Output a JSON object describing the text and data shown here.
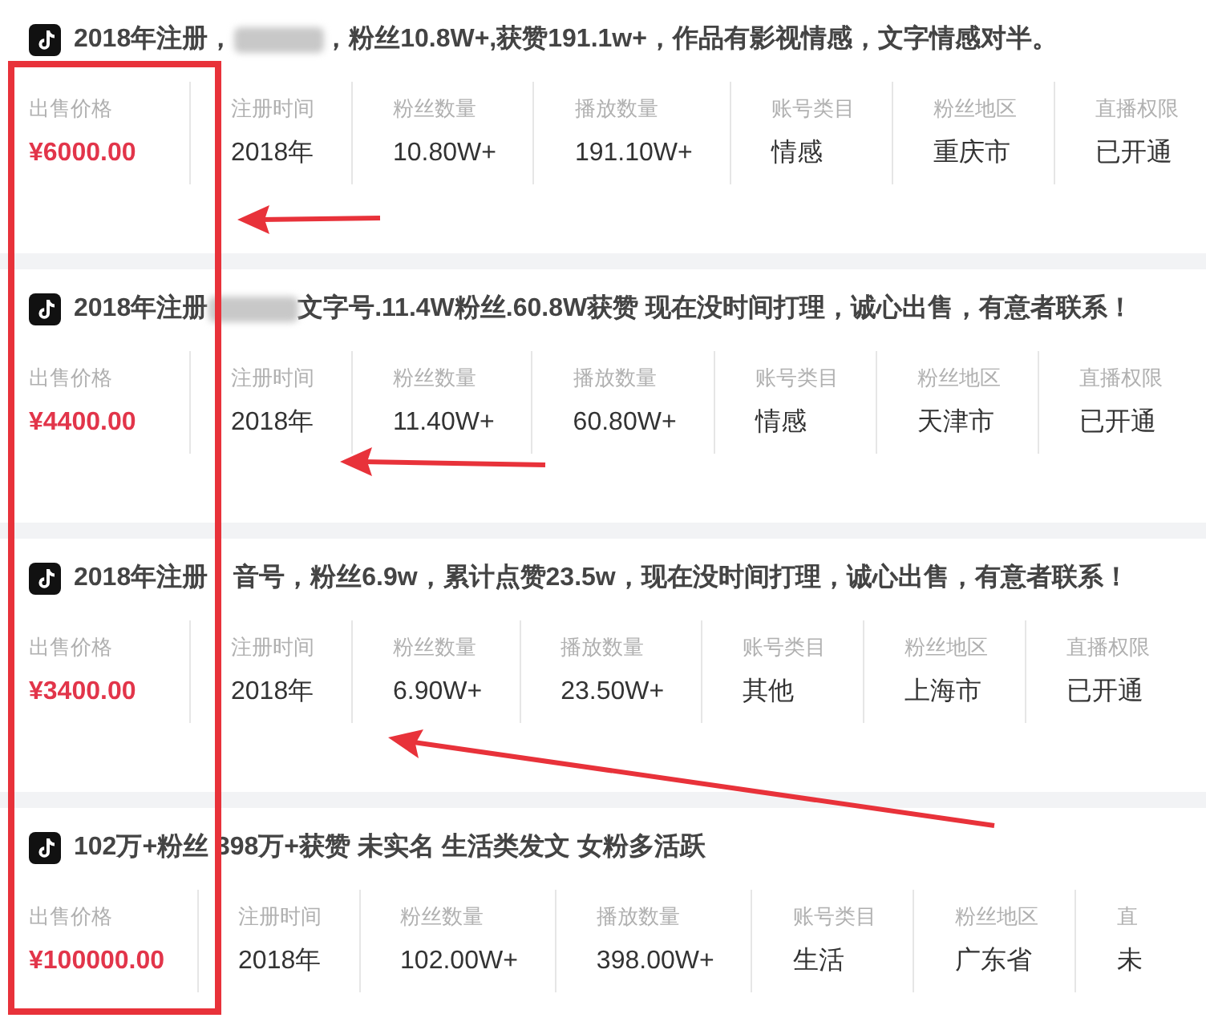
{
  "listings": [
    {
      "title": [
        {
          "kind": "text",
          "text": "2018年注册，"
        },
        {
          "kind": "redacted"
        },
        {
          "kind": "text",
          "text": "，粉丝10.8W+,获赞191.1w+，作品有影视情感，文字情感对半。"
        }
      ],
      "fields": [
        {
          "kind": "price",
          "label": "出售价格",
          "value": "¥6000.00"
        },
        {
          "kind": "plain",
          "label": "注册时间",
          "value": "2018年"
        },
        {
          "kind": "plain",
          "label": "粉丝数量",
          "value": "10.80W+"
        },
        {
          "kind": "plain",
          "label": "播放数量",
          "value": "191.10W+"
        },
        {
          "kind": "plain",
          "label": "账号类目",
          "value": "情感"
        },
        {
          "kind": "plain",
          "label": "粉丝地区",
          "value": "重庆市"
        },
        {
          "kind": "plain",
          "label": "直播权限",
          "value": "已开通"
        }
      ]
    },
    {
      "title": [
        {
          "kind": "text",
          "text": "2018年注册"
        },
        {
          "kind": "redacted"
        },
        {
          "kind": "text",
          "text": "文字号.11.4W粉丝.60.8W获赞 现在没时间打理，诚心出售，有意者联系！"
        }
      ],
      "fields": [
        {
          "kind": "price",
          "label": "出售价格",
          "value": "¥4400.00"
        },
        {
          "kind": "plain",
          "label": "注册时间",
          "value": "2018年"
        },
        {
          "kind": "plain",
          "label": "粉丝数量",
          "value": "11.40W+"
        },
        {
          "kind": "plain",
          "label": "播放数量",
          "value": "60.80W+"
        },
        {
          "kind": "plain",
          "label": "账号类目",
          "value": "情感"
        },
        {
          "kind": "plain",
          "label": "粉丝地区",
          "value": "天津市"
        },
        {
          "kind": "plain",
          "label": "直播权限",
          "value": "已开通"
        }
      ]
    },
    {
      "title": [
        {
          "kind": "text",
          "text": "2018年注册"
        },
        {
          "kind": "covered"
        },
        {
          "kind": "text",
          "text": "音号，粉丝6.9w，累计点赞23.5w，现在没时间打理，诚心出售，有意者联系！"
        }
      ],
      "fields": [
        {
          "kind": "price",
          "label": "出售价格",
          "value": "¥3400.00"
        },
        {
          "kind": "plain",
          "label": "注册时间",
          "value": "2018年"
        },
        {
          "kind": "plain",
          "label": "粉丝数量",
          "value": "6.90W+"
        },
        {
          "kind": "plain",
          "label": "播放数量",
          "value": "23.50W+"
        },
        {
          "kind": "plain",
          "label": "账号类目",
          "value": "其他"
        },
        {
          "kind": "plain",
          "label": "粉丝地区",
          "value": "上海市"
        },
        {
          "kind": "plain",
          "label": "直播权限",
          "value": "已开通"
        }
      ]
    },
    {
      "title": [
        {
          "kind": "text",
          "text": "102万+粉丝 398万+获赞 未实名 生活类发文 女粉多活跃"
        }
      ],
      "fields": [
        {
          "kind": "price",
          "label": "出售价格",
          "value": "¥100000.00"
        },
        {
          "kind": "plain",
          "label": "注册时间",
          "value": "2018年"
        },
        {
          "kind": "plain",
          "label": "粉丝数量",
          "value": "102.00W+"
        },
        {
          "kind": "plain",
          "label": "播放数量",
          "value": "398.00W+"
        },
        {
          "kind": "plain",
          "label": "账号类目",
          "value": "生活"
        },
        {
          "kind": "plain",
          "label": "粉丝地区",
          "value": "广东省"
        },
        {
          "kind": "plain",
          "label": "直",
          "value": "未"
        }
      ]
    }
  ]
}
